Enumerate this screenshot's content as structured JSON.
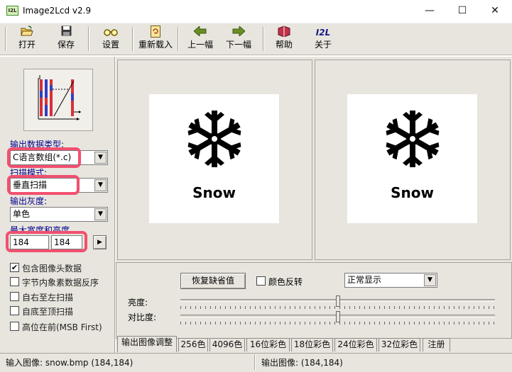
{
  "window": {
    "title": "Image2Lcd v2.9",
    "app_icon_text": "I2L",
    "minimize_glyph": "—",
    "maximize_glyph": "☐",
    "close_glyph": "✕"
  },
  "toolbar": {
    "items": [
      {
        "label": "打开",
        "icon": "open-folder-icon"
      },
      {
        "label": "保存",
        "icon": "floppy-disk-icon"
      },
      {
        "label": "设置",
        "icon": "glasses-icon"
      },
      {
        "label": "重新载入",
        "icon": "reload-document-icon"
      },
      {
        "label": "上一幅",
        "icon": "arrow-left-icon"
      },
      {
        "label": "下一幅",
        "icon": "arrow-right-icon"
      },
      {
        "label": "帮助",
        "icon": "help-book-icon"
      },
      {
        "label": "关于",
        "icon": "i2l-logo-icon"
      }
    ]
  },
  "left": {
    "output_type_label": "输出数据类型:",
    "output_type_value": "C语言数组(*.c)",
    "scan_mode_label": "扫描模式:",
    "scan_mode_value": "垂直扫描",
    "gray_label": "输出灰度:",
    "gray_value": "单色",
    "size_label": "最大宽度和高度",
    "width_value": "184",
    "height_value": "184",
    "arrow_glyph": "▶",
    "checkboxes": [
      {
        "label": "包含图像头数据",
        "checked": true
      },
      {
        "label": "字节内象素数据反序",
        "checked": false
      },
      {
        "label": "自右至左扫描",
        "checked": false
      },
      {
        "label": "自底至顶扫描",
        "checked": false
      },
      {
        "label": "高位在前(MSB First)",
        "checked": false
      }
    ],
    "check_glyph": "✔"
  },
  "preview": {
    "input_caption": "Snow",
    "output_caption": "Snow"
  },
  "adjust": {
    "restore_button": "恢复缺省值",
    "invert_label": "颜色反转",
    "invert_checked": false,
    "display_mode": "正常显示",
    "brightness_label": "亮度:",
    "contrast_label": "对比度:",
    "brightness_level": 0.5,
    "contrast_level": 0.5
  },
  "tabs": [
    "输出图像调整",
    "256色",
    "4096色",
    "16位彩色",
    "18位彩色",
    "24位彩色",
    "32位彩色",
    "注册"
  ],
  "active_tab": 0,
  "status": {
    "input": "输入图像: snow.bmp (184,184)",
    "output": "输出图像: (184,184)"
  },
  "colors": {
    "highlight": "#f2506f",
    "label_blue": "#00008b",
    "panel_bg": "#e8e5de"
  }
}
